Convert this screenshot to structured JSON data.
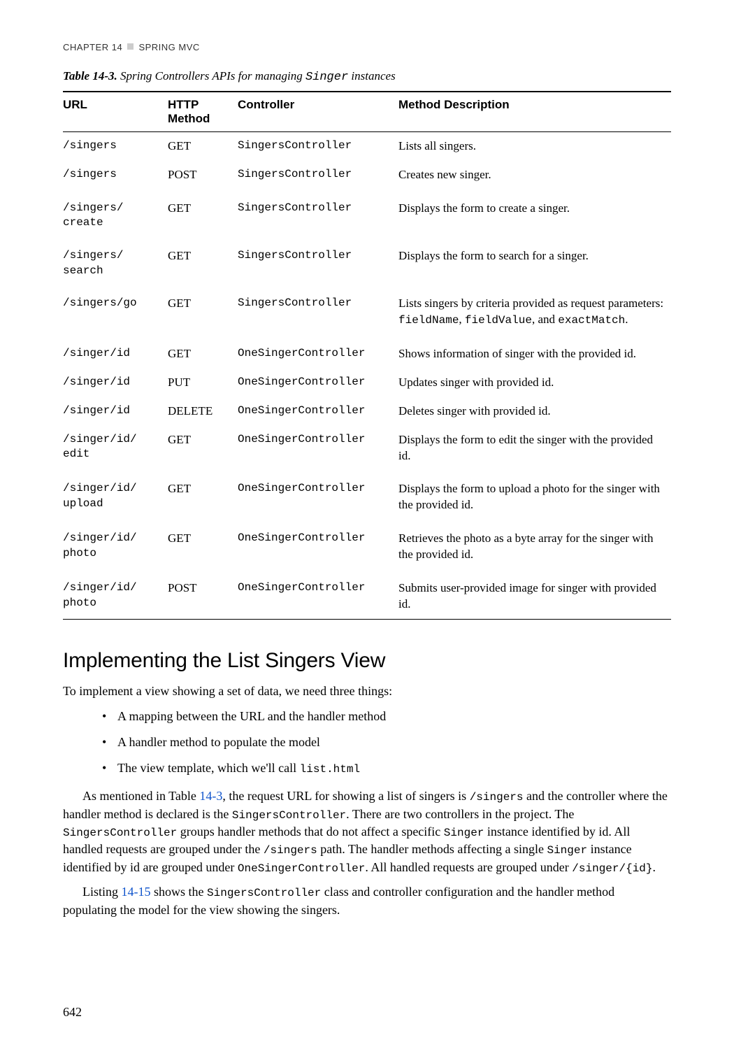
{
  "chapter": {
    "label": "CHAPTER 14",
    "title": "SPRING MVC"
  },
  "table": {
    "caption_label": "Table 14-3.",
    "caption_desc_prefix": "Spring Controllers APIs for managing ",
    "caption_code": "Singer",
    "caption_desc_suffix": " instances",
    "headers": [
      "URL",
      "HTTP Method",
      "Controller",
      "Method Description"
    ],
    "rows": [
      {
        "url": "/singers",
        "method": "GET",
        "controller": "SingersController",
        "desc": "Lists all singers."
      },
      {
        "url": "/singers",
        "method": "POST",
        "controller": "SingersController",
        "desc": "Creates new singer."
      },
      {
        "url": "/singers/\ncreate",
        "method": "GET",
        "controller": "SingersController",
        "desc": "Displays the form to create a singer.",
        "gap": true
      },
      {
        "url": "/singers/\nsearch",
        "method": "GET",
        "controller": "SingersController",
        "desc": "Displays the form to search for a singer.",
        "gap": true
      },
      {
        "url": "/singers/go",
        "method": "GET",
        "controller": "SingersController",
        "desc_html": "Lists singers by criteria provided as request parameters: <span class='mono'>fieldName</span>, <span class='mono'>fieldValue</span>, and <span class='mono'>exactMatch</span>.",
        "gap": true
      },
      {
        "url": "/singer/id",
        "method": "GET",
        "controller": "OneSingerController",
        "desc": "Shows information of singer with the provided id.",
        "gap": true
      },
      {
        "url": "/singer/id",
        "method": "PUT",
        "controller": "OneSingerController",
        "desc": "Updates singer with provided id."
      },
      {
        "url": "/singer/id",
        "method": "DELETE",
        "controller": "OneSingerController",
        "desc": "Deletes singer with provided id."
      },
      {
        "url": "/singer/id/\nedit",
        "method": "GET",
        "controller": "OneSingerController",
        "desc": "Displays the form to edit the singer with the provided id."
      },
      {
        "url": "/singer/id/\nupload",
        "method": "GET",
        "controller": "OneSingerController",
        "desc": "Displays the form to upload a photo for the singer with the provided id.",
        "gap": true
      },
      {
        "url": "/singer/id/\nphoto",
        "method": "GET",
        "controller": "OneSingerController",
        "desc": "Retrieves the photo as a byte array for the singer with the provided id.",
        "gap": true
      },
      {
        "url": "/singer/id/\nphoto",
        "method": "POST",
        "controller": "OneSingerController",
        "desc": "Submits user-provided image for singer with provided id.",
        "gap": true
      }
    ]
  },
  "section": {
    "title": "Implementing the List Singers View",
    "intro": "To implement a view showing a set of data, we need three things:",
    "bullets": [
      "A mapping between the URL and the handler method",
      "A handler method to populate the model",
      {
        "prefix": "The view template, which we'll call ",
        "code": "list.html"
      }
    ],
    "para1": {
      "t1": "As mentioned in Table ",
      "link1": "14-3",
      "t2": ", the request URL for showing a list of singers is ",
      "c1": "/singers",
      "t3": " and the controller where the handler method is declared is the ",
      "c2": "SingersController",
      "t4": ". There are two controllers in the project. The ",
      "c3": "SingersController",
      "t5": " groups handler methods that do not affect a specific ",
      "c4": "Singer",
      "t6": " instance identified by id. All handled requests are grouped under the ",
      "c5": "/singers",
      "t7": " path. The handler methods affecting a single ",
      "c6": "Singer",
      "t8": " instance identified by id are grouped under ",
      "c7": "OneSingerController",
      "t9": ". All handled requests are grouped under ",
      "c8": "/singer/{id}",
      "t10": "."
    },
    "para2": {
      "t1": "Listing ",
      "link1": "14-15",
      "t2": " shows the ",
      "c1": "SingersController",
      "t3": " class and controller configuration and the handler method populating the model for the view showing the singers."
    }
  },
  "page_number": "642"
}
